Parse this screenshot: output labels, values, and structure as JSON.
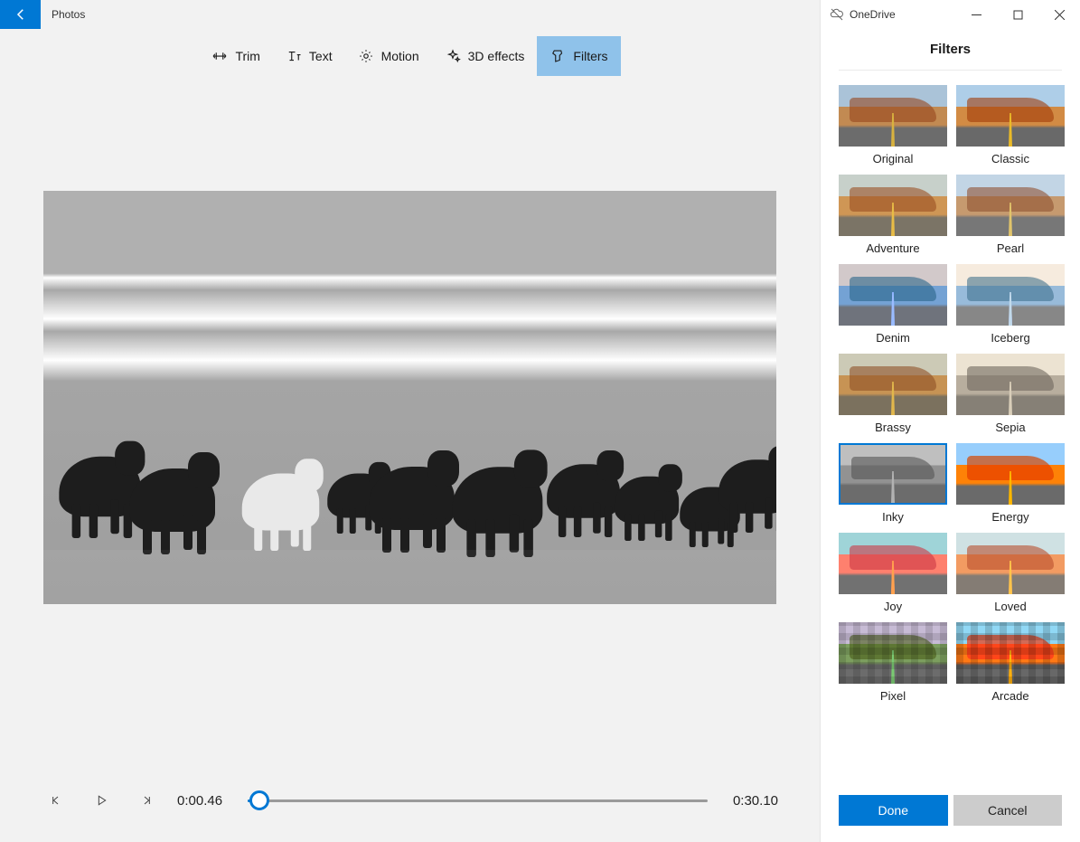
{
  "app": {
    "name": "Photos"
  },
  "titlebar": {
    "onedrive": "OneDrive"
  },
  "toolbar": {
    "items": [
      {
        "id": "trim",
        "label": "Trim"
      },
      {
        "id": "text",
        "label": "Text"
      },
      {
        "id": "motion",
        "label": "Motion"
      },
      {
        "id": "3d",
        "label": "3D effects"
      },
      {
        "id": "filters",
        "label": "Filters"
      }
    ],
    "active": "filters"
  },
  "player": {
    "current_time": "0:00.46",
    "total_time": "0:30.10",
    "position_pct": 2.5
  },
  "panel": {
    "title": "Filters",
    "selected": "Inky",
    "filters": [
      "Original",
      "Classic",
      "Adventure",
      "Pearl",
      "Denim",
      "Iceberg",
      "Brassy",
      "Sepia",
      "Inky",
      "Energy",
      "Joy",
      "Loved",
      "Pixel",
      "Arcade"
    ],
    "done": "Done",
    "cancel": "Cancel"
  },
  "colors": {
    "accent": "#0078d4"
  }
}
